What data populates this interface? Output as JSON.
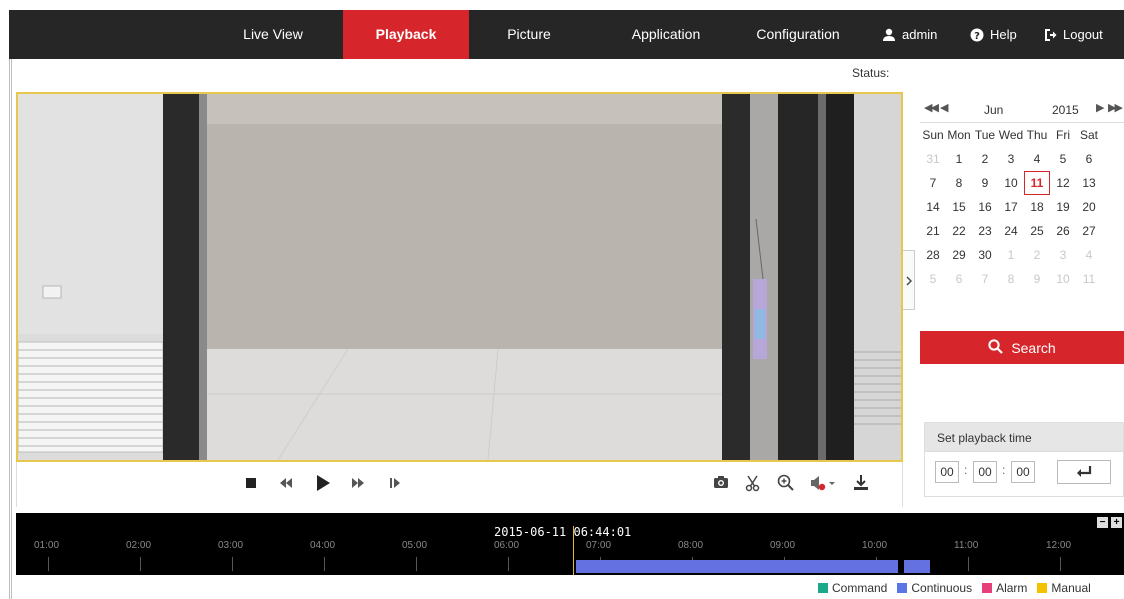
{
  "nav": {
    "items": [
      {
        "label": "Live View",
        "active": false
      },
      {
        "label": "Playback",
        "active": true
      },
      {
        "label": "Picture",
        "active": false
      },
      {
        "label": "Application",
        "active": false
      },
      {
        "label": "Configuration",
        "active": false
      }
    ],
    "user": "admin",
    "help": "Help",
    "logout": "Logout"
  },
  "status": {
    "label": "Status:"
  },
  "video": {
    "icon": "camera-feed"
  },
  "controls": {
    "left": [
      "stop-icon",
      "rewind-icon",
      "play-icon",
      "fast-forward-icon",
      "single-frame-icon"
    ],
    "right": [
      "capture-icon",
      "clip-icon",
      "digital-zoom-icon",
      "audio-icon",
      "download-icon"
    ]
  },
  "calendar": {
    "month": "Jun",
    "year": "2015",
    "weekdays": [
      "Sun",
      "Mon",
      "Tue",
      "Wed",
      "Thu",
      "Fri",
      "Sat"
    ],
    "weeks": [
      [
        "31",
        "1",
        "2",
        "3",
        "4",
        "5",
        "6"
      ],
      [
        "7",
        "8",
        "9",
        "10",
        "11",
        "12",
        "13"
      ],
      [
        "14",
        "15",
        "16",
        "17",
        "18",
        "19",
        "20"
      ],
      [
        "21",
        "22",
        "23",
        "24",
        "25",
        "26",
        "27"
      ],
      [
        "28",
        "29",
        "30",
        "1",
        "2",
        "3",
        "4"
      ],
      [
        "5",
        "6",
        "7",
        "8",
        "9",
        "10",
        "11"
      ]
    ],
    "selected": "11"
  },
  "search": {
    "label": "Search"
  },
  "playback_time": {
    "title": "Set playback time",
    "hh": "00",
    "mm": "00",
    "ss": "00",
    "sep": ":"
  },
  "timeline": {
    "current": "2015-06-11 06:44:01",
    "hours": [
      "01:00",
      "02:00",
      "03:00",
      "04:00",
      "05:00",
      "06:00",
      "07:00",
      "08:00",
      "09:00",
      "10:00",
      "11:00",
      "12:00"
    ],
    "zoom_out": "−",
    "zoom_in": "+"
  },
  "legend": [
    {
      "label": "Command",
      "color": "#1aaa8a"
    },
    {
      "label": "Continuous",
      "color": "#5b74e6"
    },
    {
      "label": "Alarm",
      "color": "#e6407a"
    },
    {
      "label": "Manual",
      "color": "#f2c200"
    }
  ],
  "colors": {
    "accent": "#d7262b",
    "navbar": "#262626",
    "timeline_record": "#6372e0"
  }
}
